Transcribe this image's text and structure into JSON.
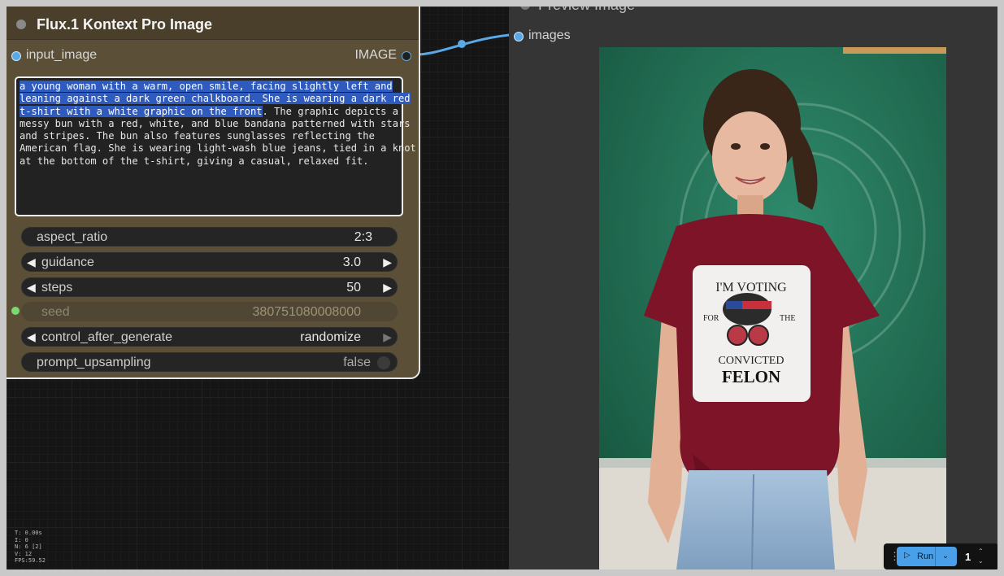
{
  "node": {
    "title": "Flux.1 Kontext Pro Image",
    "input_label": "input_image",
    "output_label": "IMAGE",
    "prompt": {
      "selected_1": "a young woman with a warm, open smile, facing slightly left and",
      "selected_2": "leaning against a dark green chalkboard. She is wearing a dark red",
      "selected_3": "t-shirt with a white graphic on the front",
      "rest_3": ". The graphic depicts a",
      "line_4": "messy bun with a red, white, and blue bandana patterned with stars",
      "line_5": "and stripes. The bun also features sunglasses reflecting the",
      "line_6": "American flag. She is wearing light-wash blue jeans, tied in a knot",
      "line_7": "at the bottom of the t-shirt, giving a casual, relaxed fit."
    },
    "widgets": {
      "aspect_ratio": {
        "label": "aspect_ratio",
        "value": "2:3"
      },
      "guidance": {
        "label": "guidance",
        "value": "3.0"
      },
      "steps": {
        "label": "steps",
        "value": "50"
      },
      "seed": {
        "label": "seed",
        "value": "380751080008000"
      },
      "control_after_generate": {
        "label": "control_after_generate",
        "value": "randomize"
      },
      "prompt_upsampling": {
        "label": "prompt_upsampling",
        "value": "false"
      }
    }
  },
  "preview": {
    "title": "Preview Image",
    "input_label": "images",
    "shirt_text": {
      "line1": "I'M VOTING",
      "for": "FOR",
      "the": "THE",
      "line3": "CONVICTED",
      "line4": "FELON"
    }
  },
  "stats": {
    "t": "T: 0.00s",
    "i": "I: 0",
    "n": "N: 6 [2]",
    "v": "V: 12",
    "fps": "FPS:59.52"
  },
  "runbar": {
    "run_label": "Run",
    "count": "1"
  },
  "colors": {
    "node_body": "#5b4f37",
    "socket_blue": "#5aa9e6",
    "seed_green": "#7bd96f",
    "run_button": "#4aa0e8"
  }
}
